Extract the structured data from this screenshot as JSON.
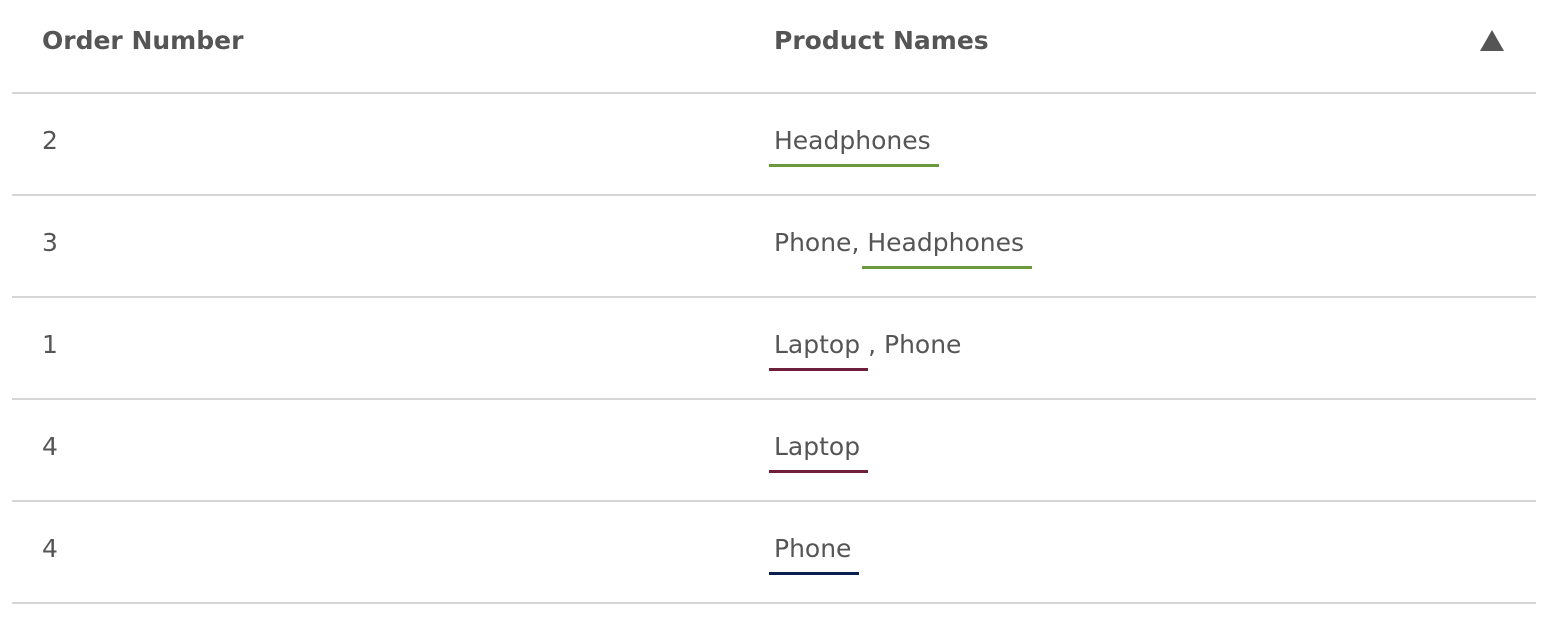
{
  "table": {
    "columns": [
      {
        "label": "Order Number"
      },
      {
        "label": "Product Names",
        "sort": "ascending",
        "sort_icon": "triangle-up-icon"
      }
    ],
    "highlight_colors": {
      "Headphones": "#6a9a3c",
      "Laptop": "#6e1f3c",
      "Phone": "#0a1f4f"
    },
    "rows": [
      {
        "order": "2",
        "products": [
          {
            "text": "Headphones",
            "highlight": "#6a9a3c"
          }
        ]
      },
      {
        "order": "3",
        "products": [
          {
            "text": "Phone",
            "highlight": null
          },
          {
            "text": "Headphones",
            "highlight": "#6a9a3c"
          }
        ]
      },
      {
        "order": "1",
        "products": [
          {
            "text": "Laptop",
            "highlight": "#6e1f3c"
          },
          {
            "text": "Phone",
            "highlight": null
          }
        ]
      },
      {
        "order": "4",
        "products": [
          {
            "text": "Laptop",
            "highlight": "#6e1f3c"
          }
        ]
      },
      {
        "order": "4",
        "products": [
          {
            "text": "Phone",
            "highlight": "#0a1f4f"
          }
        ]
      }
    ]
  }
}
